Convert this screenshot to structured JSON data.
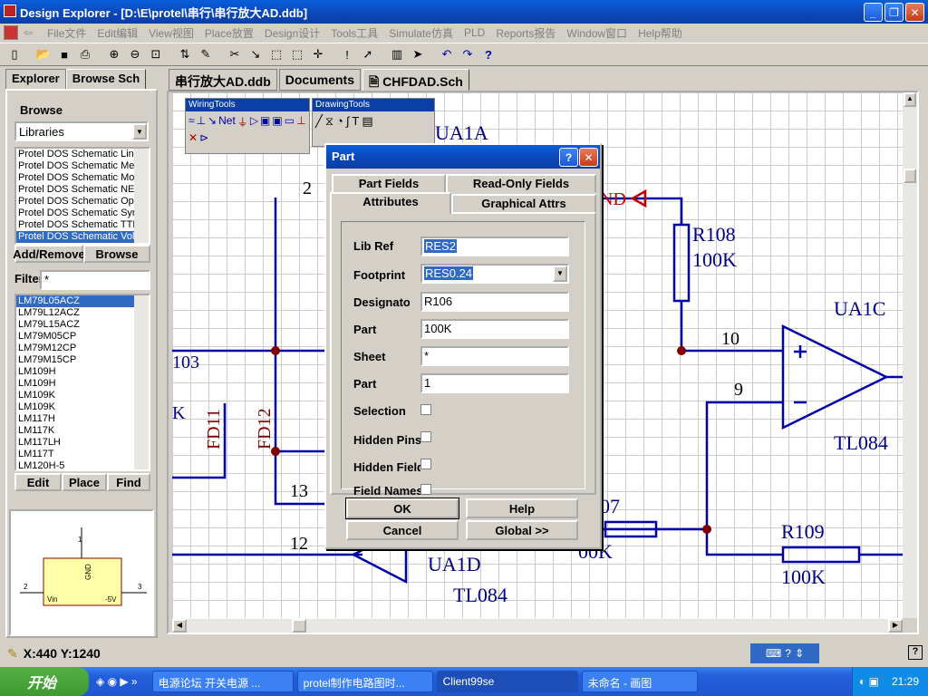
{
  "window": {
    "title": "Design Explorer - [D:\\E\\protel\\串行\\串行放大AD.ddb]"
  },
  "menu": [
    "File文件",
    "Edit编辑",
    "View视图",
    "Place放置",
    "Design设计",
    "Tools工具",
    "Simulate仿真",
    "PLD",
    "Reports报告",
    "Window窗口",
    "Help帮助"
  ],
  "left": {
    "tabs": [
      "Explorer",
      "Browse Sch"
    ],
    "browse_label": "Browse",
    "browse_value": "Libraries",
    "libraries": [
      "Protel DOS Schematic Line",
      "Protel DOS Schematic Mem",
      "Protel DOS Schematic Mot",
      "Protel DOS Schematic NEC",
      "Protel DOS Schematic Ope",
      "Protel DOS Schematic Syn",
      "Protel DOS Schematic TTL",
      "Protel DOS Schematic Volt"
    ],
    "add_remove": "Add/Remove",
    "browse_btn": "Browse",
    "filter_label": "Filter",
    "filter_value": "*",
    "components": [
      "LM79L05ACZ",
      "LM79L12ACZ",
      "LM79L15ACZ",
      "LM79M05CP",
      "LM79M12CP",
      "LM79M15CP",
      "LM109H",
      "LM109H",
      "LM109K",
      "LM109K",
      "LM117H",
      "LM117K",
      "LM117LH",
      "LM117T",
      "LM120H-5"
    ],
    "edit_btn": "Edit",
    "place_btn": "Place",
    "find_btn": "Find",
    "preview": {
      "pin_top": "1",
      "pin_left": "2",
      "pin_right": "3",
      "label_gnd": "GND",
      "label_vin": "Vin",
      "label_out": "-5V"
    }
  },
  "doc_tabs": [
    "串行放大AD.ddb",
    "Documents",
    "CHFDAD.Sch"
  ],
  "wiring_tools": {
    "title": "WiringTools"
  },
  "drawing_tools": {
    "title": "DrawingTools"
  },
  "schematic": {
    "labels": [
      "UA1A",
      "2",
      "103",
      "K",
      "FD11",
      "FD12",
      "13",
      "12",
      "UA1D",
      "TL084",
      "R108",
      "100K",
      "10",
      "9",
      "UA1C",
      "TL084",
      "R109",
      "100K",
      "07",
      "00K",
      "ND"
    ]
  },
  "dialog": {
    "title": "Part",
    "tabs": [
      "Part Fields",
      "Read-Only Fields",
      "Attributes",
      "Graphical Attrs"
    ],
    "fields": [
      {
        "label": "Lib Ref",
        "value": "RES2"
      },
      {
        "label": "Footprint",
        "value": "RES0.24"
      },
      {
        "label": "Designator",
        "value": "R106"
      },
      {
        "label": "Part",
        "value": "100K"
      },
      {
        "label": "Sheet",
        "value": "*"
      },
      {
        "label": "Part",
        "value": "1"
      }
    ],
    "checks": [
      "Selection",
      "Hidden Pins",
      "Hidden Fields",
      "Field Names"
    ],
    "ok": "OK",
    "help": "Help",
    "cancel": "Cancel",
    "global": "Global >>"
  },
  "status": {
    "coords": "X:440 Y:1240"
  },
  "taskbar": {
    "start": "开始",
    "tasks": [
      "电源论坛 开关电源 ...",
      "protel制作电路图时...",
      "Client99se",
      "未命名 - 画图"
    ],
    "clock": "21:29"
  },
  "colors": {
    "wire": "#0000a8",
    "junction": "#800000",
    "text": "#000080",
    "label_red": "#c00000"
  }
}
